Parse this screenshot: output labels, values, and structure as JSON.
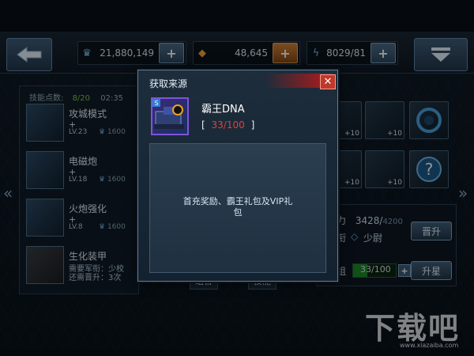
{
  "resources": {
    "crystal": "21,880,149",
    "gold": "48,645",
    "energy": "8029/81"
  },
  "skills_panel": {
    "points_label": "技能点数:",
    "points_value": "8/20",
    "timer": "02:35",
    "items": [
      {
        "name": "攻城模式",
        "plus": "+",
        "level": "LV.23",
        "cost": "1600"
      },
      {
        "name": "电磁炮",
        "plus": "+",
        "level": "LV.18",
        "cost": "1600"
      },
      {
        "name": "火炮强化",
        "plus": "+",
        "level": "LV.8",
        "cost": "1600"
      },
      {
        "name": "生化装甲",
        "req1": "需要军衔：少校",
        "req2": "还需晋升：3次"
      }
    ]
  },
  "right_panel": {
    "slot_tags": [
      "+10",
      "+10",
      "+10",
      "+10"
    ],
    "power_label": "力",
    "power_value": "3428/",
    "power_max": "4200",
    "rank_label": "衔",
    "rank_value": "少尉",
    "frag_label": "组",
    "frag_value": "33/100",
    "frag_progress": 0.33,
    "promote_label": "晋升",
    "star_label": "升星"
  },
  "bottom_tabs": [
    "组合",
    "技能"
  ],
  "modal": {
    "title": "获取来源",
    "item_name": "霸王DNA",
    "count_open": "[",
    "count_value": "33/100",
    "count_close": "]",
    "source": "首充奖励、霸王礼包及VIP礼包"
  },
  "watermark": {
    "logo": "下载吧",
    "url": "www.xiazaiba.com"
  },
  "colors": {
    "accent_red": "#c0392b",
    "frame_blue": "#5e7f9a",
    "count_red": "#e04040",
    "progress_green": "#1e8a2a"
  }
}
